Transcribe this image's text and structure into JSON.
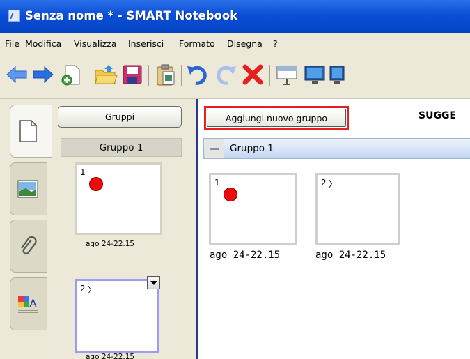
{
  "window": {
    "title": "Senza nome * - SMART Notebook"
  },
  "menubar": {
    "items": [
      "File",
      "Modifica",
      "Visualizza",
      "Inserisci",
      "Formato",
      "Disegna",
      "?"
    ]
  },
  "toolbar": {
    "buttons": [
      "back-arrow-icon",
      "forward-arrow-icon",
      "new-page-icon",
      "open-folder-icon",
      "save-icon",
      "paste-icon",
      "undo-icon",
      "redo-icon",
      "delete-icon",
      "screen-shade-icon",
      "full-screen-icon",
      "dual-page-icon"
    ],
    "colors": {
      "arrow": "#3d7be0",
      "delete": "#e62020",
      "new_page": "#39a33a"
    }
  },
  "side_tabs": [
    "page-sorter-icon",
    "gallery-icon",
    "attachments-icon",
    "properties-icon"
  ],
  "sorter": {
    "groups_button": "Gruppi",
    "group_label": "Gruppo 1",
    "thumbnails": [
      {
        "number": "1",
        "caption": "ago 24-22.15",
        "has_dot": true
      },
      {
        "number": "2",
        "caption": "ago 24-22.15",
        "has_dot": false
      }
    ]
  },
  "main": {
    "add_group_button": "Aggiungi nuovo gruppo",
    "hint": "SUGGE",
    "group": {
      "name": "Gruppo 1"
    },
    "pages": [
      {
        "number": "1",
        "caption": "ago 24-22.15",
        "has_dot": true
      },
      {
        "number": "2",
        "caption": "ago 24-22.15",
        "has_dot": false
      }
    ],
    "highlight_color": "#e62020",
    "dot_color": "#ee0a0a"
  }
}
